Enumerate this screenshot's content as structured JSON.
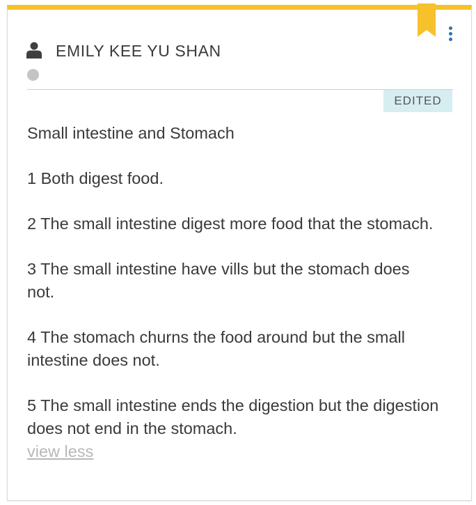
{
  "post": {
    "author": "EMILY KEE YU SHAN",
    "status_badge": "EDITED",
    "paragraphs": [
      "Small intestine and Stomach",
      "1 Both digest food.",
      "2 The small intestine digest more food that the stomach.",
      "3 The small intestine have vills but the stomach does not.",
      "4 The stomach churns the food around but the small intestine does not.",
      "5 The small intestine ends the digestion but the digestion does not end in the stomach."
    ],
    "toggle_label": "view less"
  },
  "icons": {
    "bookmark": "bookmark-icon",
    "menu": "more-vertical-icon",
    "user": "user-icon",
    "status": "status-dot"
  },
  "colors": {
    "card_accent": "#f6c12b",
    "menu_dots": "#2f6fb6",
    "badge_bg": "#d7eef1",
    "link_muted": "#b8b8b8"
  }
}
